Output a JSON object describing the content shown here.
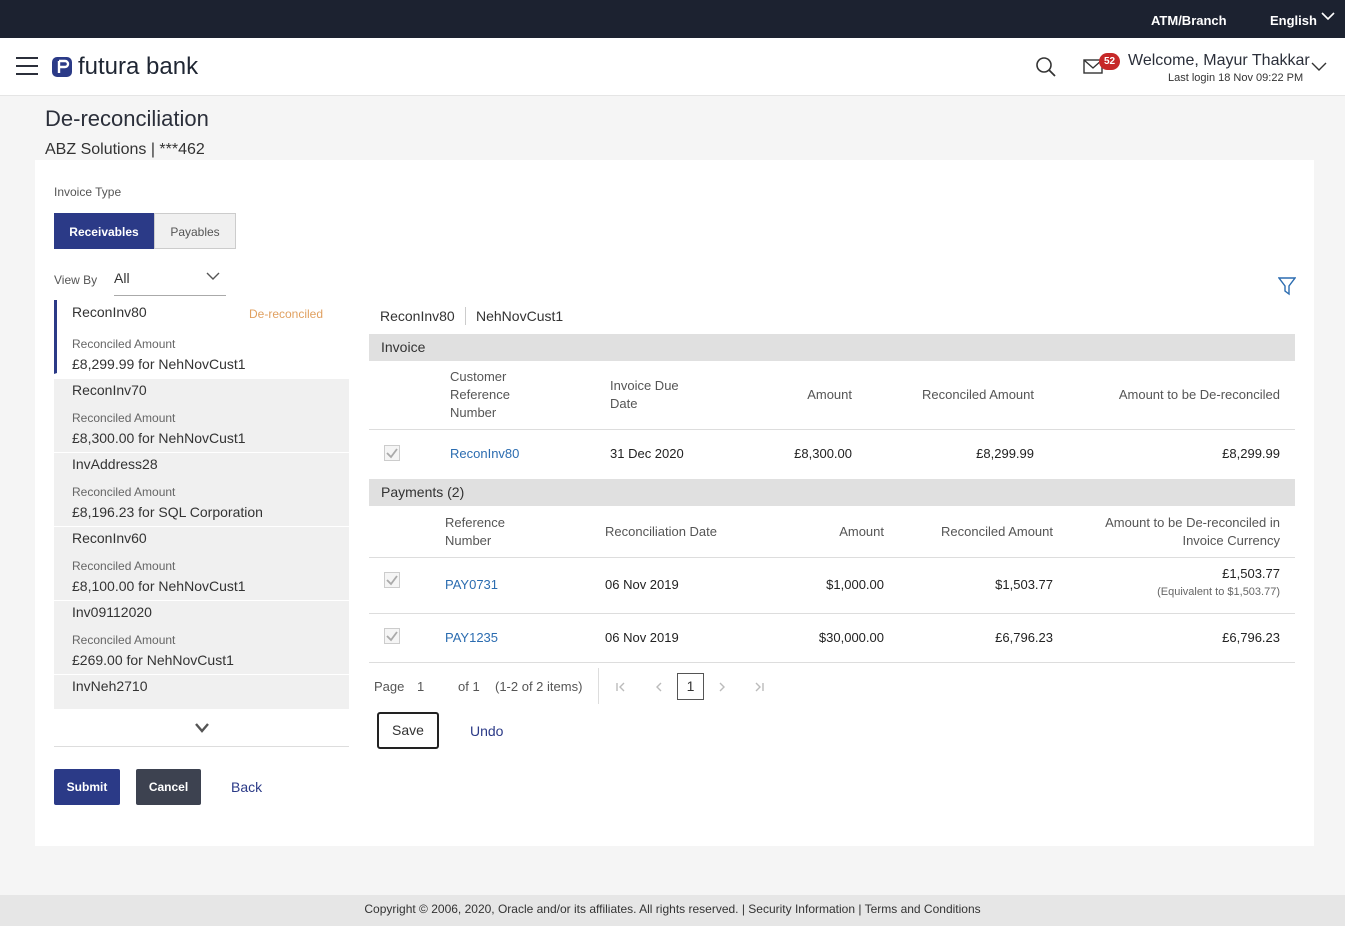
{
  "topbar": {
    "atm": "ATM/Branch",
    "language": "English"
  },
  "header": {
    "brand": "futura bank",
    "notification_count": "52",
    "welcome": "Welcome, Mayur Thakkar",
    "last_login": "Last login 18 Nov 09:22 PM"
  },
  "page": {
    "title": "De-reconciliation",
    "subtitle": "ABZ Solutions | ***462"
  },
  "filters": {
    "invoice_type_label": "Invoice Type",
    "toggle_receivables": "Receivables",
    "toggle_payables": "Payables",
    "view_by_label": "View By",
    "view_by_value": "All"
  },
  "invoice_list": [
    {
      "ref": "ReconInv80",
      "status": "De-reconciled",
      "amount_label": "Reconciled Amount",
      "amount": "£8,299.99 for NehNovCust1"
    },
    {
      "ref": "ReconInv70",
      "status": "",
      "amount_label": "Reconciled Amount",
      "amount": "£8,300.00 for NehNovCust1"
    },
    {
      "ref": "InvAddress28",
      "status": "",
      "amount_label": "Reconciled Amount",
      "amount": "£8,196.23 for SQL Corporation"
    },
    {
      "ref": "ReconInv60",
      "status": "",
      "amount_label": "Reconciled Amount",
      "amount": "£8,100.00 for NehNovCust1"
    },
    {
      "ref": "Inv09112020",
      "status": "",
      "amount_label": "Reconciled Amount",
      "amount": "£269.00 for NehNovCust1"
    },
    {
      "ref": "InvNeh2710",
      "status": "",
      "amount_label": "",
      "amount": ""
    }
  ],
  "actions": {
    "submit": "Submit",
    "cancel": "Cancel",
    "back": "Back",
    "save": "Save",
    "undo": "Undo"
  },
  "detail": {
    "crumb_invoice": "ReconInv80",
    "crumb_customer": "NehNovCust1",
    "invoice_section": "Invoice",
    "invoice_headers": {
      "customer_ref": "Customer Reference Number",
      "due_date": "Invoice Due Date",
      "amount": "Amount",
      "reconciled": "Reconciled Amount",
      "to_dereconcile": "Amount to be De-reconciled"
    },
    "invoice_row": {
      "ref": "ReconInv80",
      "due_date": "31 Dec 2020",
      "amount": "£8,300.00",
      "reconciled": "£8,299.99",
      "to_dereconcile": "£8,299.99"
    },
    "payments_section": "Payments (2)",
    "payment_headers": {
      "ref": "Reference Number",
      "date": "Reconciliation Date",
      "amount": "Amount",
      "reconciled": "Reconciled Amount",
      "to_dereconcile": "Amount to be De-reconciled in Invoice Currency"
    },
    "payments": [
      {
        "ref": "PAY0731",
        "date": "06 Nov 2019",
        "amount": "$1,000.00",
        "reconciled": "$1,503.77",
        "to_dereconcile": "£1,503.77",
        "equivalent": "(Equivalent to $1,503.77)"
      },
      {
        "ref": "PAY1235",
        "date": "06 Nov 2019",
        "amount": "$30,000.00",
        "reconciled": "£6,796.23",
        "to_dereconcile": "£6,796.23",
        "equivalent": ""
      }
    ],
    "pagination": {
      "page_label": "Page",
      "page_value": "1",
      "of_label": "of 1",
      "items": "(1-2 of 2 items)",
      "current": "1"
    }
  },
  "footer": "Copyright © 2006, 2020, Oracle and/or its affiliates. All rights reserved. | Security Information | Terms and Conditions",
  "colors": {
    "primary": "#2b3a87",
    "topbar": "#1c2230",
    "badge": "#c62828",
    "status": "#e0a060",
    "link": "#2b6cb0"
  }
}
